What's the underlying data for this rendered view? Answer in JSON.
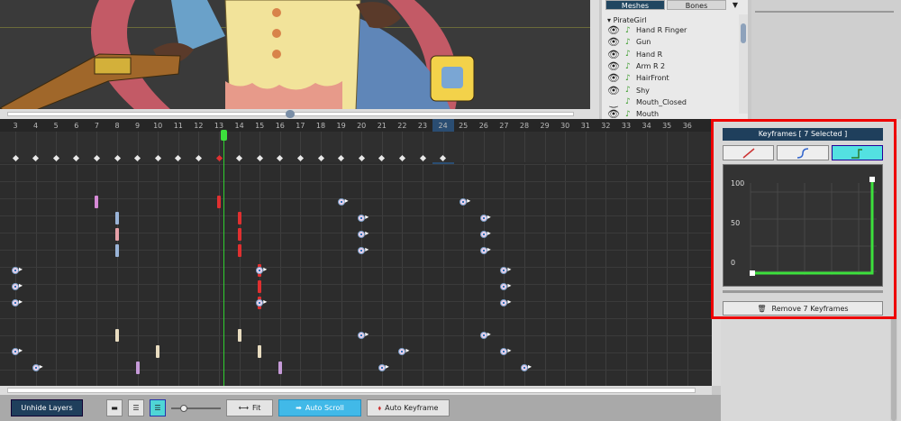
{
  "layers_panel": {
    "tabs": [
      {
        "label": "Meshes",
        "active": true
      },
      {
        "label": "Bones",
        "active": false
      }
    ],
    "menu_glyph": "▼",
    "root": "PirateGirl",
    "items": [
      {
        "name": "Hand R Finger",
        "visible": true
      },
      {
        "name": "Gun",
        "visible": true
      },
      {
        "name": "Hand R",
        "visible": true
      },
      {
        "name": "Arm R 2",
        "visible": true
      },
      {
        "name": "HairFront",
        "visible": true
      },
      {
        "name": "Shy",
        "visible": true
      },
      {
        "name": "Mouth_Closed",
        "visible": false
      },
      {
        "name": "Mouth",
        "visible": true
      }
    ]
  },
  "timeline": {
    "frames": [
      "3",
      "4",
      "5",
      "6",
      "7",
      "8",
      "9",
      "10",
      "11",
      "12",
      "13",
      "14",
      "15",
      "16",
      "17",
      "18",
      "19",
      "20",
      "21",
      "22",
      "23",
      "24",
      "25",
      "26",
      "27",
      "28",
      "29",
      "30",
      "31",
      "32",
      "33",
      "34",
      "35",
      "36"
    ],
    "current_frame": "13",
    "selection_range": [
      "23",
      "24"
    ]
  },
  "toolbar": {
    "unhide_layers": "Unhide Layers",
    "fit": "Fit",
    "auto_scroll": "Auto Scroll",
    "auto_keyframe": "Auto Keyframe"
  },
  "keyframes_panel": {
    "title": "Keyframes [ 7 Selected ]",
    "modes": [
      {
        "name": "linear",
        "active": false
      },
      {
        "name": "smooth",
        "active": false
      },
      {
        "name": "constant",
        "active": true
      }
    ],
    "curve_labels": [
      "100",
      "50",
      "0"
    ],
    "remove_button": "Remove 7 Keyframes"
  },
  "colors": {
    "accent_cyan": "#53e1e1",
    "selection_border": "#ee0000",
    "playhead": "#2fd02f",
    "title_bg": "#1f3f5c"
  }
}
